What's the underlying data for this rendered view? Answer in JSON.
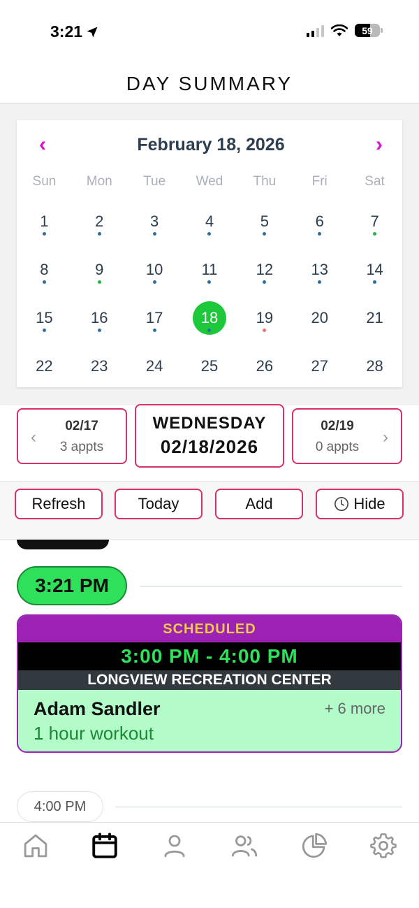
{
  "status_bar": {
    "time": "3:21",
    "battery": "59"
  },
  "header": {
    "title": "DAY SUMMARY"
  },
  "calendar": {
    "month_label": "February 18, 2026",
    "prev_icon": "chevron-left-icon",
    "next_icon": "chevron-right-icon",
    "weekdays": [
      "Sun",
      "Mon",
      "Tue",
      "Wed",
      "Thu",
      "Fri",
      "Sat"
    ],
    "selected_day": 18,
    "days": [
      {
        "n": "1",
        "dot": "#2f6f9f"
      },
      {
        "n": "2",
        "dot": "#2f6f9f"
      },
      {
        "n": "3",
        "dot": "#2f6f9f"
      },
      {
        "n": "4",
        "dot": "#2f6f9f"
      },
      {
        "n": "5",
        "dot": "#2f6f9f"
      },
      {
        "n": "6",
        "dot": "#2f6f9f"
      },
      {
        "n": "7",
        "dot": "#2bb04a"
      },
      {
        "n": "8",
        "dot": "#2f6f9f"
      },
      {
        "n": "9",
        "dot": "#2bb04a"
      },
      {
        "n": "10",
        "dot": "#2f6f9f"
      },
      {
        "n": "11",
        "dot": "#2f6f9f"
      },
      {
        "n": "12",
        "dot": "#2f6f9f"
      },
      {
        "n": "13",
        "dot": "#2f6f9f"
      },
      {
        "n": "14",
        "dot": "#2f6f9f"
      },
      {
        "n": "15",
        "dot": "#2f6f9f"
      },
      {
        "n": "16",
        "dot": "#2f6f9f"
      },
      {
        "n": "17",
        "dot": "#2f6f9f"
      },
      {
        "n": "18",
        "dot": "#2f6f9f"
      },
      {
        "n": "19",
        "dot": "#f07070"
      },
      {
        "n": "20",
        "dot": ""
      },
      {
        "n": "21",
        "dot": ""
      },
      {
        "n": "22",
        "dot": ""
      },
      {
        "n": "23",
        "dot": ""
      },
      {
        "n": "24",
        "dot": ""
      },
      {
        "n": "25",
        "dot": ""
      },
      {
        "n": "26",
        "dot": ""
      },
      {
        "n": "27",
        "dot": ""
      },
      {
        "n": "28",
        "dot": ""
      }
    ]
  },
  "day_nav": {
    "prev": {
      "date": "02/17",
      "appts": "3 appts"
    },
    "current": {
      "weekday": "WEDNESDAY",
      "date": "02/18/2026"
    },
    "next": {
      "date": "02/19",
      "appts": "0 appts"
    }
  },
  "actions": {
    "refresh": "Refresh",
    "today": "Today",
    "add": "Add",
    "hide": "Hide",
    "hide_icon": "clock-icon"
  },
  "schedule": {
    "now": "3:21 PM",
    "event": {
      "status": "SCHEDULED",
      "time": "3:00 PM - 4:00 PM",
      "location": "LONGVIEW RECREATION CENTER",
      "name": "Adam Sandler",
      "more": "+ 6 more",
      "description": "1 hour workout"
    },
    "next_slot": "4:00 PM"
  },
  "tabbar": {
    "items": [
      "home-icon",
      "calendar-icon",
      "person-icon",
      "people-icon",
      "pie-chart-icon",
      "gear-icon"
    ],
    "active": "calendar-icon"
  },
  "colors": {
    "accent_border": "#d8306b",
    "selected_day": "#1dc93a",
    "event_header": "#9b22b3",
    "event_body": "#b3fbc9",
    "chevron": "#e010d0"
  }
}
